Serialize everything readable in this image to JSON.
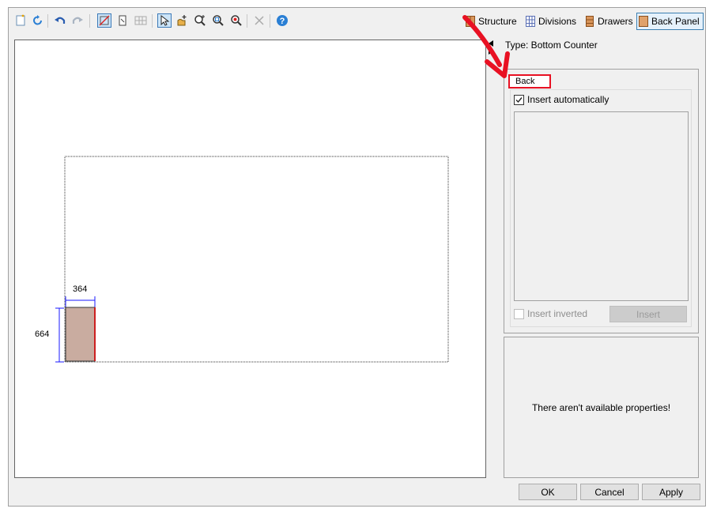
{
  "toolbar": {
    "left_icons": [
      "new-icon",
      "refresh-icon",
      "undo-icon",
      "redo-icon",
      "structure-edit-icon",
      "panel-edit-icon",
      "grid-icon",
      "pointer-icon",
      "hand-add-icon",
      "zoom-in-icon",
      "zoom-window-icon",
      "zoom-fit-icon",
      "delete-icon",
      "help-icon"
    ],
    "modes": [
      {
        "label": "Structure",
        "icon": "structure-icon"
      },
      {
        "label": "Divisions",
        "icon": "divisions-icon"
      },
      {
        "label": "Drawers",
        "icon": "drawers-icon"
      },
      {
        "label": "Back Panel",
        "icon": "back-panel-icon",
        "active": true
      }
    ]
  },
  "type_label": "Type: Bottom Counter",
  "canvas": {
    "width_dimension": "364",
    "height_dimension": "664",
    "colors": {
      "panel_fill": "#c9aca0",
      "panel_edge": "#cc1f1f",
      "dimension_line": "#1a1aff"
    }
  },
  "back_group": {
    "tab_label": "Back",
    "insert_automatically": {
      "label": "Insert automatically",
      "checked": true
    },
    "insert_inverted": {
      "label": "Insert inverted",
      "checked": false,
      "enabled": false
    },
    "insert_button": "Insert"
  },
  "properties_message": "There aren't available properties!",
  "footer": {
    "ok": "OK",
    "cancel": "Cancel",
    "apply": "Apply"
  },
  "annotation": {
    "color": "#e81123",
    "icon": "red-arrow-icon"
  }
}
